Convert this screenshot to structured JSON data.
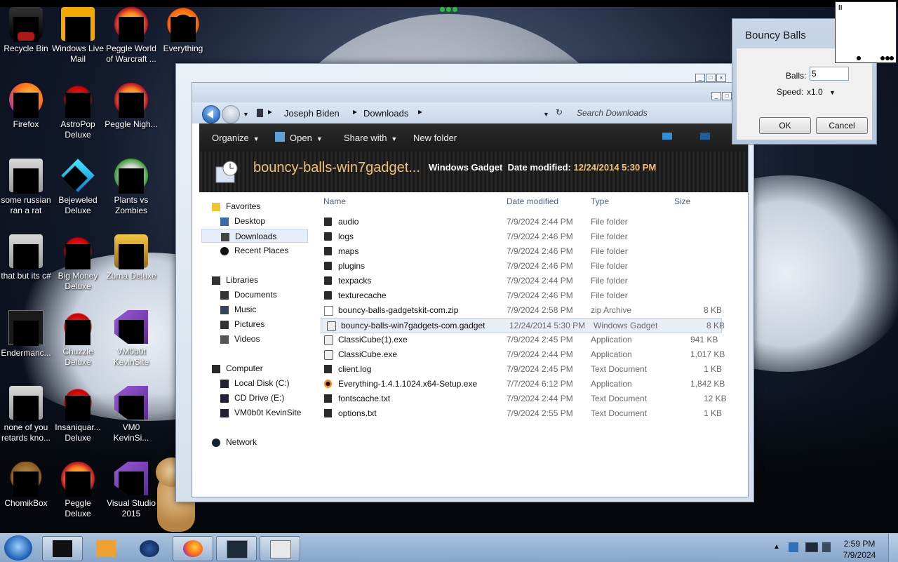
{
  "desktop": {
    "icons": [
      {
        "label": "Recycle Bin",
        "icon": "recycle-bin-icon"
      },
      {
        "label": "Windows Live Mail",
        "icon": "mail-icon"
      },
      {
        "label": "Peggle World of Warcraft ...",
        "icon": "peggle-icon"
      },
      {
        "label": "Everything",
        "icon": "everything-icon"
      },
      {
        "label": "Firefox",
        "icon": "firefox-icon"
      },
      {
        "label": "AstroPop Deluxe",
        "icon": "game-icon"
      },
      {
        "label": "Peggle Nigh...",
        "icon": "peggle-icon"
      },
      {
        "label": "some russian ran a rat",
        "icon": "app-icon"
      },
      {
        "label": "Bejeweled Deluxe",
        "icon": "gem-icon"
      },
      {
        "label": "Plants vs Zombies",
        "icon": "plant-icon"
      },
      {
        "label": "that but its c#",
        "icon": "app-icon"
      },
      {
        "label": "Big Money Deluxe",
        "icon": "game-icon"
      },
      {
        "label": "Zuma Deluxe",
        "icon": "zuma-icon"
      },
      {
        "label": "Endermanc...",
        "icon": "terminal-icon"
      },
      {
        "label": "Chuzzle Deluxe",
        "icon": "game-icon"
      },
      {
        "label": "VM0b0t KevinSite",
        "icon": "shortcut-icon"
      },
      {
        "label": "none of you retards kno...",
        "icon": "app-icon"
      },
      {
        "label": "Insaniquar... Deluxe",
        "icon": "game-icon"
      },
      {
        "label": "VM0 KevinSi...",
        "icon": "shortcut-icon"
      },
      {
        "label": "ChomikBox",
        "icon": "chomikbox-icon"
      },
      {
        "label": "Peggle Deluxe",
        "icon": "peggle-icon"
      },
      {
        "label": "Visual Studio 2015",
        "icon": "visual-studio-icon"
      }
    ]
  },
  "explorer": {
    "breadcrumb": [
      "Joseph Biden",
      "Downloads"
    ],
    "search_placeholder": "Search Downloads",
    "toolbar": {
      "organize": "Organize",
      "open": "Open",
      "share": "Share with",
      "new_folder": "New folder"
    },
    "details": {
      "name": "bouncy-balls-win7gadget...",
      "type": "Windows Gadget",
      "date_label": "Date modified:",
      "date_value": "12/24/2014 5:30 PM"
    },
    "nav": {
      "favorites": "Favorites",
      "desktop": "Desktop",
      "downloads": "Downloads",
      "recent": "Recent Places",
      "libraries": "Libraries",
      "documents": "Documents",
      "music": "Music",
      "pictures": "Pictures",
      "videos": "Videos",
      "computer": "Computer",
      "local_disk": "Local Disk (C:)",
      "cd_drive": "CD Drive (E:)",
      "vm": "VM0b0t KevinSite",
      "network": "Network"
    },
    "columns": {
      "name": "Name",
      "date": "Date modified",
      "type": "Type",
      "size": "Size"
    },
    "files": [
      {
        "name": "audio",
        "date": "7/9/2024 2:44 PM",
        "type": "File folder",
        "size": "",
        "icon": "folder"
      },
      {
        "name": "logs",
        "date": "7/9/2024 2:46 PM",
        "type": "File folder",
        "size": "",
        "icon": "folder"
      },
      {
        "name": "maps",
        "date": "7/9/2024 2:46 PM",
        "type": "File folder",
        "size": "",
        "icon": "folder"
      },
      {
        "name": "plugins",
        "date": "7/9/2024 2:46 PM",
        "type": "File folder",
        "size": "",
        "icon": "folder"
      },
      {
        "name": "texpacks",
        "date": "7/9/2024 2:44 PM",
        "type": "File folder",
        "size": "",
        "icon": "folder"
      },
      {
        "name": "texturecache",
        "date": "7/9/2024 2:46 PM",
        "type": "File folder",
        "size": "",
        "icon": "folder"
      },
      {
        "name": "bouncy-balls-gadgetskit-com.zip",
        "date": "7/9/2024 2:58 PM",
        "type": "zip Archive",
        "size": "8 KB",
        "icon": "zip"
      },
      {
        "name": "bouncy-balls-win7gadgets-com.gadget",
        "date": "12/24/2014 5:30 PM",
        "type": "Windows Gadget",
        "size": "8 KB",
        "icon": "gadget"
      },
      {
        "name": "ClassiCube(1).exe",
        "date": "7/9/2024 2:45 PM",
        "type": "Application",
        "size": "941 KB",
        "icon": "app"
      },
      {
        "name": "ClassiCube.exe",
        "date": "7/9/2024 2:44 PM",
        "type": "Application",
        "size": "1,017 KB",
        "icon": "app"
      },
      {
        "name": "client.log",
        "date": "7/9/2024 2:45 PM",
        "type": "Text Document",
        "size": "1 KB",
        "icon": "doc"
      },
      {
        "name": "Everything-1.4.1.1024.x64-Setup.exe",
        "date": "7/7/2024 6:12 PM",
        "type": "Application",
        "size": "1,842 KB",
        "icon": "everything"
      },
      {
        "name": "fontscache.txt",
        "date": "7/9/2024 2:44 PM",
        "type": "Text Document",
        "size": "12 KB",
        "icon": "doc"
      },
      {
        "name": "options.txt",
        "date": "7/9/2024 2:55 PM",
        "type": "Text Document",
        "size": "1 KB",
        "icon": "doc"
      }
    ]
  },
  "dialog": {
    "title": "Bouncy Balls",
    "balls_label": "Balls:",
    "balls_value": "5",
    "speed_label": "Speed:",
    "speed_value": "x1.0",
    "ok": "OK",
    "cancel": "Cancel"
  },
  "gadget_preview": {
    "pause": "II"
  },
  "taskbar": {
    "time": "2:59 PM",
    "date": "7/9/2024"
  }
}
